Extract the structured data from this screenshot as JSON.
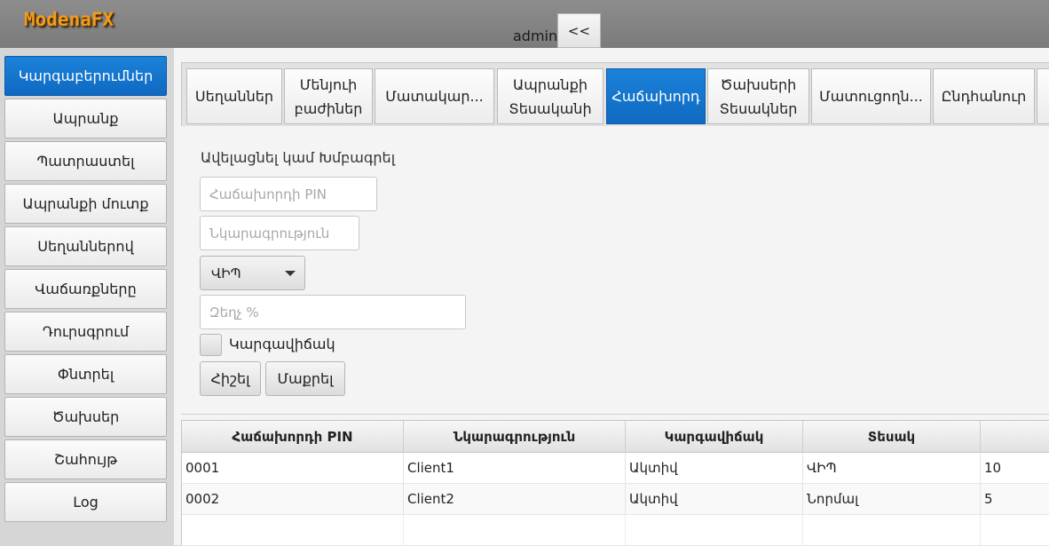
{
  "app": {
    "logo": "ModenaFX",
    "user": "admin",
    "collapse_label": "<<"
  },
  "sidebar": {
    "items": [
      {
        "label": "Կարգաբերումներ",
        "active": true
      },
      {
        "label": "Ապրանք",
        "active": false
      },
      {
        "label": "Պատրաստել",
        "active": false
      },
      {
        "label": "Ապրանքի մուտք",
        "active": false
      },
      {
        "label": "Սեղաններով",
        "active": false
      },
      {
        "label": "Վաճառքները",
        "active": false
      },
      {
        "label": "Դուրսգրում",
        "active": false
      },
      {
        "label": "Փնտրել",
        "active": false
      },
      {
        "label": "Ծախսեր",
        "active": false
      },
      {
        "label": "Շահույթ",
        "active": false
      },
      {
        "label": "Log",
        "active": false
      }
    ]
  },
  "tabs": [
    {
      "label": "Սեղաններ",
      "active": false
    },
    {
      "label": "Մենյուի\nբաժիներ",
      "active": false
    },
    {
      "label": "Մատակար...",
      "active": false
    },
    {
      "label": "Ապրանքի\nՏեսականի",
      "active": false
    },
    {
      "label": "Հաճախորդ",
      "active": true
    },
    {
      "label": "Ծախսերի\nՏեսակներ",
      "active": false
    },
    {
      "label": "Մատուցողն...",
      "active": false
    },
    {
      "label": "Ընդհանուր",
      "active": false
    }
  ],
  "form": {
    "title": "Ավելացնել կամ Խմբագրել",
    "pin_placeholder": "Հաճախորդի PIN",
    "description_placeholder": "Նկարագրություն",
    "type_selected": "ՎԻՊ",
    "discount_placeholder": "Զեղչ %",
    "status_label": "Կարգավիճակ",
    "save_label": "Հիշել",
    "clear_label": "Մաքրել"
  },
  "table": {
    "columns": [
      "Հաճախորդի PIN",
      "Նկարագրություն",
      "Կարգավիճակ",
      "Տեսակ",
      ""
    ],
    "rows": [
      [
        "0001",
        "Client1",
        "Ակտիվ",
        "ՎԻՊ",
        "10"
      ],
      [
        "0002",
        "Client2",
        "Ակտիվ",
        "Նորմալ",
        "5"
      ]
    ]
  },
  "colors": {
    "accent": "#1478d0",
    "logo": "#f39c1c"
  }
}
